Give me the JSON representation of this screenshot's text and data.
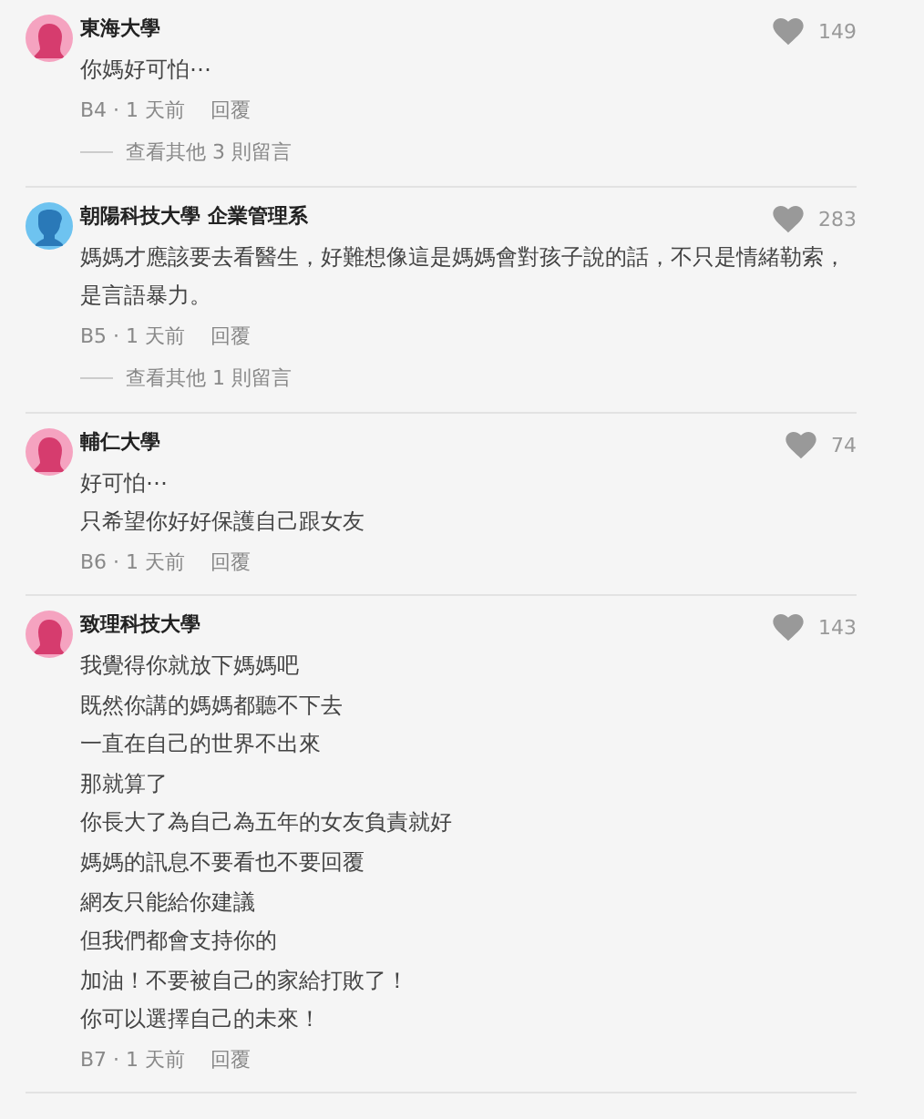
{
  "comments": [
    {
      "author": "東海大學",
      "kind": "female",
      "likes": "149",
      "paragraphs": [
        "你媽好可怕⋯"
      ],
      "floor": "B4 · 1 天前",
      "reply": "回覆",
      "view_replies": "查看其他 3 則留言"
    },
    {
      "author": "朝陽科技大學 企業管理系",
      "kind": "male",
      "likes": "283",
      "paragraphs": [
        "媽媽才應該要去看醫生，好難想像這是媽媽會對孩子說的話，不只是情緒勒索，是言語暴力。"
      ],
      "floor": "B5 · 1 天前",
      "reply": "回覆",
      "view_replies": "查看其他 1 則留言"
    },
    {
      "author": "輔仁大學",
      "kind": "female",
      "likes": "74",
      "paragraphs": [
        "好可怕⋯",
        "只希望你好好保護自己跟女友"
      ],
      "floor": "B6 · 1 天前",
      "reply": "回覆"
    },
    {
      "author": "致理科技大學",
      "kind": "female",
      "likes": "143",
      "paragraphs": [
        "我覺得你就放下媽媽吧",
        "既然你講的媽媽都聽不下去",
        "一直在自己的世界不出來",
        "那就算了",
        "你長大了為自己為五年的女友負責就好",
        "媽媽的訊息不要看也不要回覆",
        "網友只能給你建議",
        "但我們都會支持你的",
        "加油！不要被自己的家給打敗了！",
        "你可以選擇自己的未來！"
      ],
      "floor": "B7 · 1 天前",
      "reply": "回覆"
    }
  ]
}
